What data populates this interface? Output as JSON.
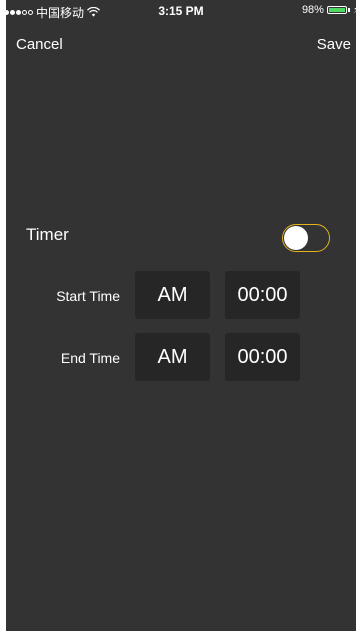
{
  "status_bar": {
    "carrier": "中国移动",
    "time": "3:15 PM",
    "battery": "98%",
    "battery_level": 0.98
  },
  "nav": {
    "cancel_label": "Cancel",
    "save_label": "Save"
  },
  "timer": {
    "label": "Timer",
    "enabled": false,
    "toggle_border_color": "#e3b21d"
  },
  "rows": [
    {
      "label": "Start Time",
      "ampm": "AM",
      "time": "00:00"
    },
    {
      "label": "End Time",
      "ampm": "AM",
      "time": "00:00"
    }
  ],
  "colors": {
    "background": "#333333",
    "box_background": "#262626",
    "accent": "#e3b21d",
    "battery_fill": "#4cd964"
  }
}
